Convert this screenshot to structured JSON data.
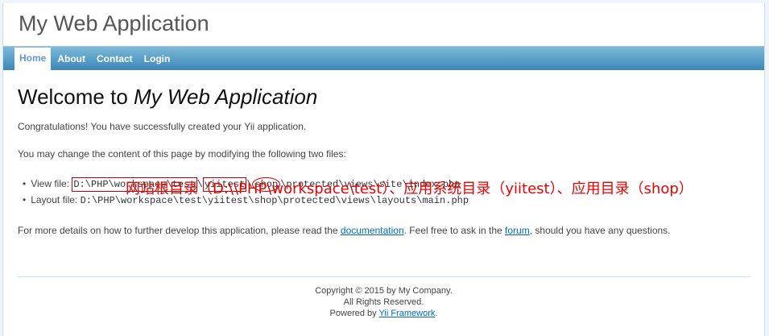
{
  "header": {
    "logo": "My Web Application"
  },
  "menu": {
    "items": [
      {
        "label": "Home"
      },
      {
        "label": "About"
      },
      {
        "label": "Contact"
      },
      {
        "label": "Login"
      }
    ]
  },
  "main": {
    "heading_prefix": "Welcome to ",
    "heading_app": "My Web Application",
    "congrats": "Congratulations! You have successfully created your Yii application.",
    "change_text": "You may change the content of this page by modifying the following two files:",
    "view_file_label": "View file: ",
    "view_path_root": "D:\\PHP\\workspace\\test",
    "view_path_sep1": "\\",
    "view_path_app": "yiitest",
    "view_path_sep2": "\\",
    "view_path_shop": "shop",
    "view_path_rest": "\\protected\\views\\site\\index.php",
    "layout_file_label": "Layout file: ",
    "layout_path": "D:\\PHP\\workspace\\test\\yiitest\\shop\\protected\\views\\layouts\\main.php",
    "details_before": "For more details on how to further develop this application, please read the ",
    "documentation_link": "documentation",
    "details_middle": ". Feel free to ask in the ",
    "forum_link": "forum",
    "details_after": ", should you have any questions."
  },
  "annotation": "网站根目录（D:\\\\PHP\\workspace\\test）、应用系统目录（yiitest）、应用目录（shop）",
  "footer": {
    "copyright": "Copyright © 2015 by My Company.",
    "rights": "All Rights Reserved.",
    "powered_prefix": "Powered by ",
    "powered_link": "Yii Framework",
    "powered_suffix": "."
  },
  "colors": {
    "menu_bar": "#5ea3cb",
    "link": "#0066cc",
    "annotation": "#ee0000"
  }
}
